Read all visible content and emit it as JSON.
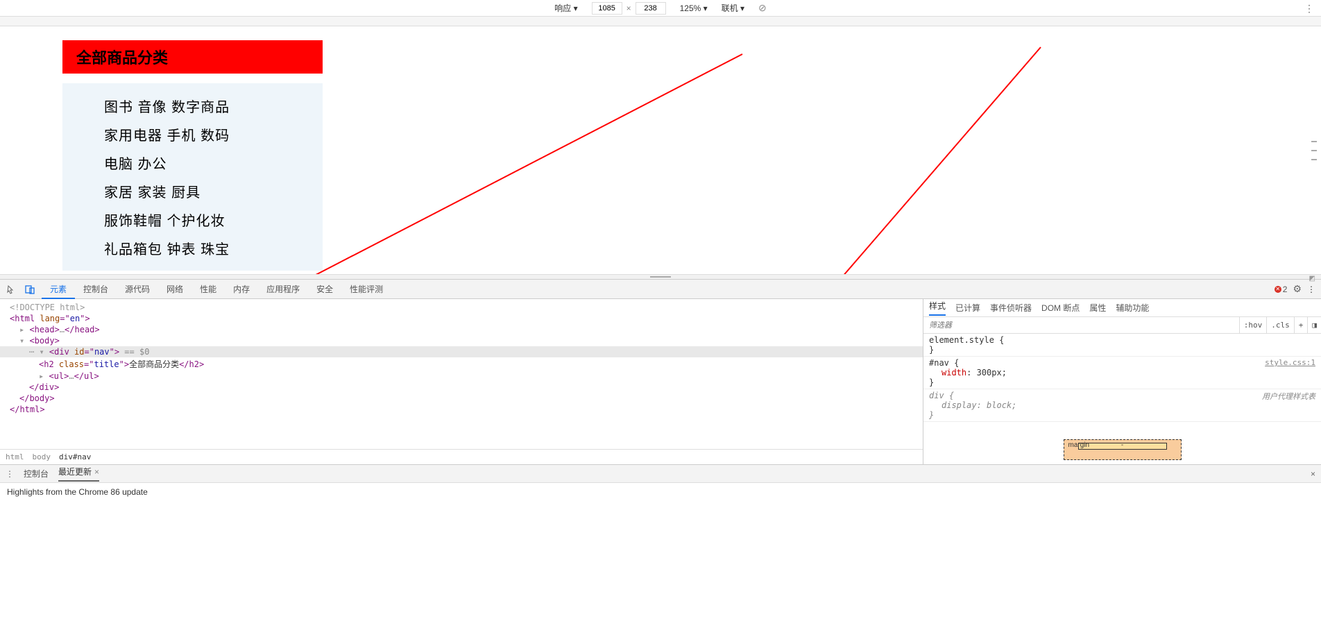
{
  "toolbar": {
    "responsive_label": "响应 ▾",
    "width": "1085",
    "separator": "×",
    "height": "238",
    "zoom": "125% ▾",
    "online": "联机 ▾"
  },
  "page": {
    "nav_title": "全部商品分类",
    "categories": [
      "图书  音像  数字商品",
      "家用电器  手机  数码",
      "电脑  办公",
      "家居  家装  厨具",
      "服饰鞋帽  个护化妆",
      "礼品箱包  钟表  珠宝"
    ]
  },
  "tabs": {
    "elements": "元素",
    "console": "控制台",
    "sources": "源代码",
    "network": "网络",
    "performance": "性能",
    "memory": "内存",
    "application": "应用程序",
    "security": "安全",
    "lighthouse": "性能评测"
  },
  "errors_count": "2",
  "dom": {
    "doctype": "<!DOCTYPE html>",
    "html_open": "<html lang=\"en\">",
    "head": "<head>…</head>",
    "body_open": "<body>",
    "nav_open_pre": "<div id=\"nav\">",
    "nav_open_suffix": " == $0",
    "h2": "<h2 class=\"title\">全部商品分类</h2>",
    "ul": "<ul>…</ul>",
    "nav_close": "</div>",
    "body_close": "</body>",
    "html_close": "</html>"
  },
  "breadcrumb": {
    "html": "html",
    "body": "body",
    "nav": "div#nav"
  },
  "styles_tabs": {
    "styles": "样式",
    "computed": "已计算",
    "listeners": "事件侦听器",
    "dom_bp": "DOM 断点",
    "props": "属性",
    "a11y": "辅助功能"
  },
  "filter": {
    "placeholder": "筛选器",
    "hov": ":hov",
    "cls": ".cls"
  },
  "rules": {
    "element_style": "element.style",
    "nav_selector": "#nav",
    "nav_source": "style.css:1",
    "nav_prop": "width",
    "nav_val": "300px",
    "div_selector": "div",
    "ua_label": "用户代理样式表",
    "div_prop": "display",
    "div_val": "block"
  },
  "box_model": {
    "margin_label": "margin",
    "dash": "-"
  },
  "drawer": {
    "console": "控制台",
    "whatsnew": "最近更新",
    "message": "Highlights from the Chrome 86 update"
  }
}
